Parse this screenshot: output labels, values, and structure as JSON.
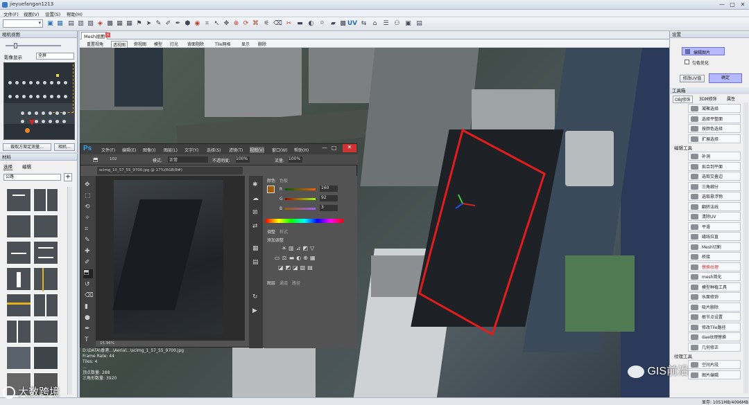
{
  "window": {
    "title": "jieyuefangan1213",
    "min": "—",
    "max": "□",
    "close": "✕"
  },
  "menu": [
    "文件(F)",
    "视图(V)",
    "设置(S)",
    "帮助(H)"
  ],
  "toolbar": {
    "dropdown_value": "",
    "icons": [
      "select-arrow-icon",
      "save-icon",
      "open-icon",
      "paint-icon",
      "uv-icon",
      "box-icon",
      "sphere-icon",
      "cut-icon",
      "transform-icon",
      "camera-icon"
    ],
    "uv_label": "UV"
  },
  "camera_panel": {
    "title": "相机视图",
    "label": "影像显示",
    "select_value": "全屏",
    "btn1": "裁取方案定测量...",
    "btn2": "相机..."
  },
  "material_panel": {
    "title": "材料",
    "tabs": [
      "选择",
      "编辑"
    ],
    "select_value": "公路"
  },
  "view": {
    "tab": "Mesh视图",
    "subtabs": [
      "重置视角",
      "透视图",
      "俯视图",
      "模型",
      "灯光",
      "背面剔除",
      "Tile网格",
      "显示",
      "删除"
    ]
  },
  "scene_overlay": [
    "D:\\DATA\\香港...\\Aerial...\\scimg_1_57_55_9700.jpg",
    "Frame Rate: 44",
    "Tiles: 4",
    "...",
    "顶点数量: 288",
    "三角形数量: 3920"
  ],
  "photoshop": {
    "logo": "Ps",
    "menus": [
      "文件(F)",
      "编辑(E)",
      "图像(I)",
      "图层(L)",
      "文字(Y)",
      "选择(S)",
      "滤镜(T)",
      "视图(V)",
      "窗口(W)",
      "帮助(H)"
    ],
    "options": {
      "mode_label": "模式:",
      "mode_value": "正常",
      "opacity_label": "不透明度:",
      "opacity": "100%",
      "flow_label": "流量:",
      "flow": "100%",
      "size": "102"
    },
    "doc_tab": "scimg_10_57_55_9700.jpg @ 17%(RGB/8#)",
    "zoom": "15.96%",
    "color_panel": {
      "tabs": [
        "颜色",
        "色板"
      ],
      "r": "160",
      "g": "92",
      "b": "3",
      "r_label": "R",
      "g_label": "G",
      "b_label": "B"
    },
    "adjust_panel": {
      "tabs": [
        "调整",
        "样式"
      ],
      "add": "添加调整"
    },
    "layers_panel": {
      "tabs": [
        "图层",
        "通道",
        "路径"
      ]
    }
  },
  "right": {
    "title": "设置",
    "edit_image": "编辑图片",
    "even_color": "匀色优化",
    "btn_uv": "修改UV值",
    "btn_ok": "确定",
    "tools_title": "工具箱",
    "tools_tabs": [
      "OBJ修饰",
      "3DM修饰",
      "属性"
    ],
    "items_top": [
      "凝聚选择",
      "选择平整面",
      "按颜色选择",
      "扩展选择"
    ],
    "group_edit": "编辑工具",
    "items_edit": [
      "补洞",
      "拟合到平面",
      "选取交叠边",
      "三角细分",
      "选取悬浮物",
      "翻转法线",
      "清除UV",
      "平滑",
      "缝线拉直",
      "Mesh切割",
      "桥接",
      "替换纹理",
      "mesh简化",
      "模型种植工具",
      "水面修饰",
      "吸片删除",
      "根节点设置",
      "修改Tile路径",
      "dae纹理替换",
      "几何修正"
    ],
    "group_tex": "纹理工具",
    "items_tex": [
      "空间片段",
      "图片编辑"
    ]
  },
  "status": {
    "memory": "显存: 1051MB/4096MB"
  },
  "watermark": {
    "left": "大数跨境",
    "right": "GIS前沿"
  }
}
